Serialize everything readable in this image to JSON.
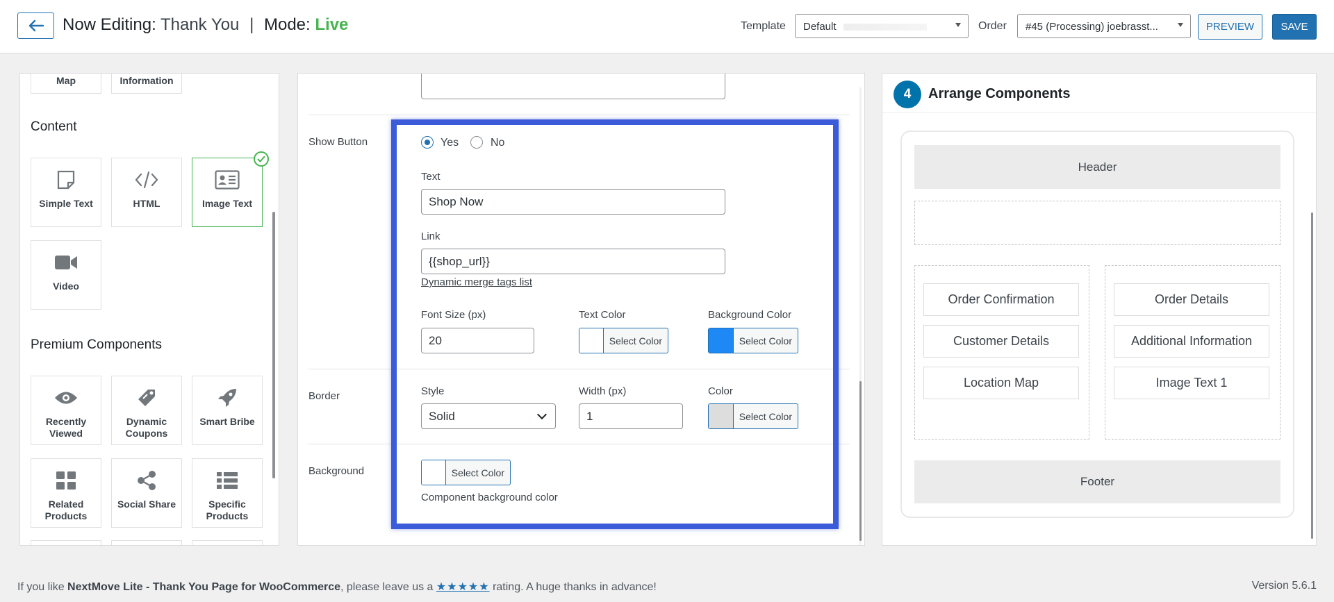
{
  "header": {
    "editing_label": "Now Editing:",
    "editing_value": "Thank You",
    "separator": "|",
    "mode_label": "Mode:",
    "mode_value": "Live",
    "template_label": "Template",
    "template_value": "Default",
    "order_label": "Order",
    "order_value": "#45 (Processing) joebrasst...",
    "preview_label": "PREVIEW",
    "save_label": "SAVE"
  },
  "left_panel": {
    "top_partial": [
      {
        "label": "Map",
        "icon": "map-icon"
      },
      {
        "label": "Information",
        "icon": "info-icon"
      }
    ],
    "content_heading": "Content",
    "content_items": [
      {
        "label": "Simple Text",
        "icon": "note-icon"
      },
      {
        "label": "HTML",
        "icon": "code-icon"
      },
      {
        "label": "Image Text",
        "icon": "image-text-icon",
        "selected": true
      },
      {
        "label": "Video",
        "icon": "video-icon"
      }
    ],
    "premium_heading": "Premium Components",
    "premium_items": [
      {
        "label": "Recently Viewed",
        "icon": "eye-icon"
      },
      {
        "label": "Dynamic Coupons",
        "icon": "coupon-icon"
      },
      {
        "label": "Smart Bribe",
        "icon": "rocket-icon"
      },
      {
        "label": "Related Products",
        "icon": "grid-icon"
      },
      {
        "label": "Social Share",
        "icon": "share-icon"
      },
      {
        "label": "Specific Products",
        "icon": "list-icon"
      }
    ]
  },
  "settings": {
    "show_button_label": "Show Button",
    "radio_yes": "Yes",
    "radio_no": "No",
    "radio_selected": "Yes",
    "text_label": "Text",
    "text_value": "Shop Now",
    "link_label": "Link",
    "link_value": "{{shop_url}}",
    "merge_tags_link": "Dynamic merge tags list",
    "font_size_label": "Font Size (px)",
    "font_size_value": "20",
    "text_color_label": "Text Color",
    "text_color_button": "Select Color",
    "text_color_swatch": "#ffffff",
    "bg_color_label": "Background Color",
    "bg_color_button": "Select Color",
    "bg_color_swatch": "#1e88f5",
    "border_label": "Border",
    "style_label": "Style",
    "style_value": "Solid",
    "width_label": "Width (px)",
    "width_value": "1",
    "color_label": "Color",
    "color_button": "Select Color",
    "color_swatch": "#dddddd",
    "background_label": "Background",
    "background_button": "Select Color",
    "background_help": "Component background color",
    "highlight_color": "#3b5bd9"
  },
  "arrange": {
    "step": "4",
    "title": "Arrange Components",
    "header_bar": "Header",
    "footer_bar": "Footer",
    "left_column": [
      "Order Confirmation",
      "Customer Details",
      "Location Map"
    ],
    "right_column": [
      "Order Details",
      "Additional Information",
      "Image Text 1"
    ]
  },
  "footer": {
    "prefix": "If you like",
    "plugin_name": "NextMove Lite - Thank You Page for WooCommerce",
    "middle": ", please leave us a",
    "stars": "★★★★★",
    "suffix": "rating. A huge thanks in advance!",
    "version": "Version 5.6.1"
  },
  "colors": {
    "accent": "#2271b1",
    "live": "#46b450",
    "step_badge": "#0073aa"
  }
}
